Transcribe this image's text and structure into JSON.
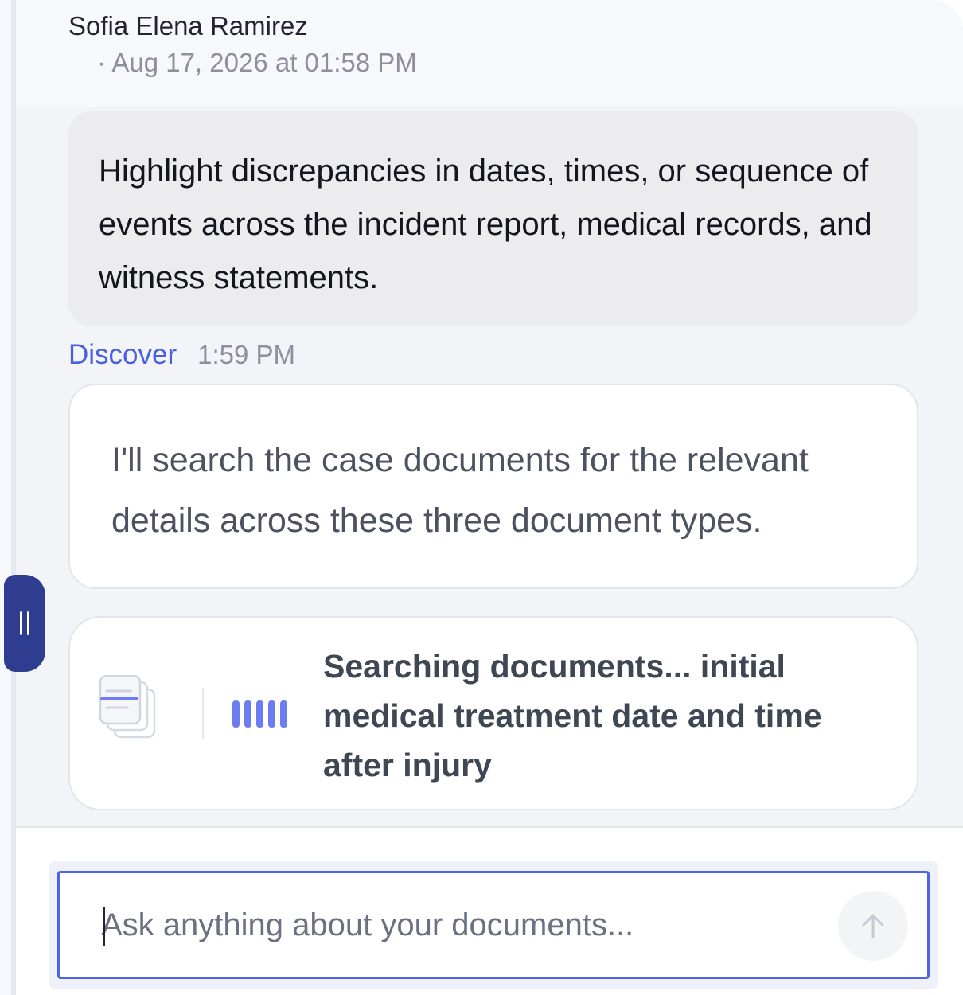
{
  "header": {
    "sender_name": "Sofia Elena Ramirez",
    "sender_time": "· Aug 17, 2026 at 01:58 PM"
  },
  "user_message": {
    "text": "Highlight discrepancies in dates, times, or sequence of events across the incident report, medical records, and witness statements."
  },
  "assistant": {
    "name": "Discover",
    "time": "1:59 PM",
    "message": "I'll search the case documents for the relevant details across these three document types."
  },
  "search_card": {
    "icon": "documents-icon",
    "progress_icon": "progress-bars-icon",
    "status_text": "Searching documents... initial medical treatment date and time after injury"
  },
  "composer": {
    "value": "",
    "placeholder": "Ask anything about your documents...",
    "send_icon": "arrow-up-icon"
  },
  "resize_handle": {
    "icon": "grip-icon"
  },
  "colors": {
    "accent": "#4e63e6",
    "handle": "#2e3d8f",
    "progress": "#6b7df0"
  }
}
